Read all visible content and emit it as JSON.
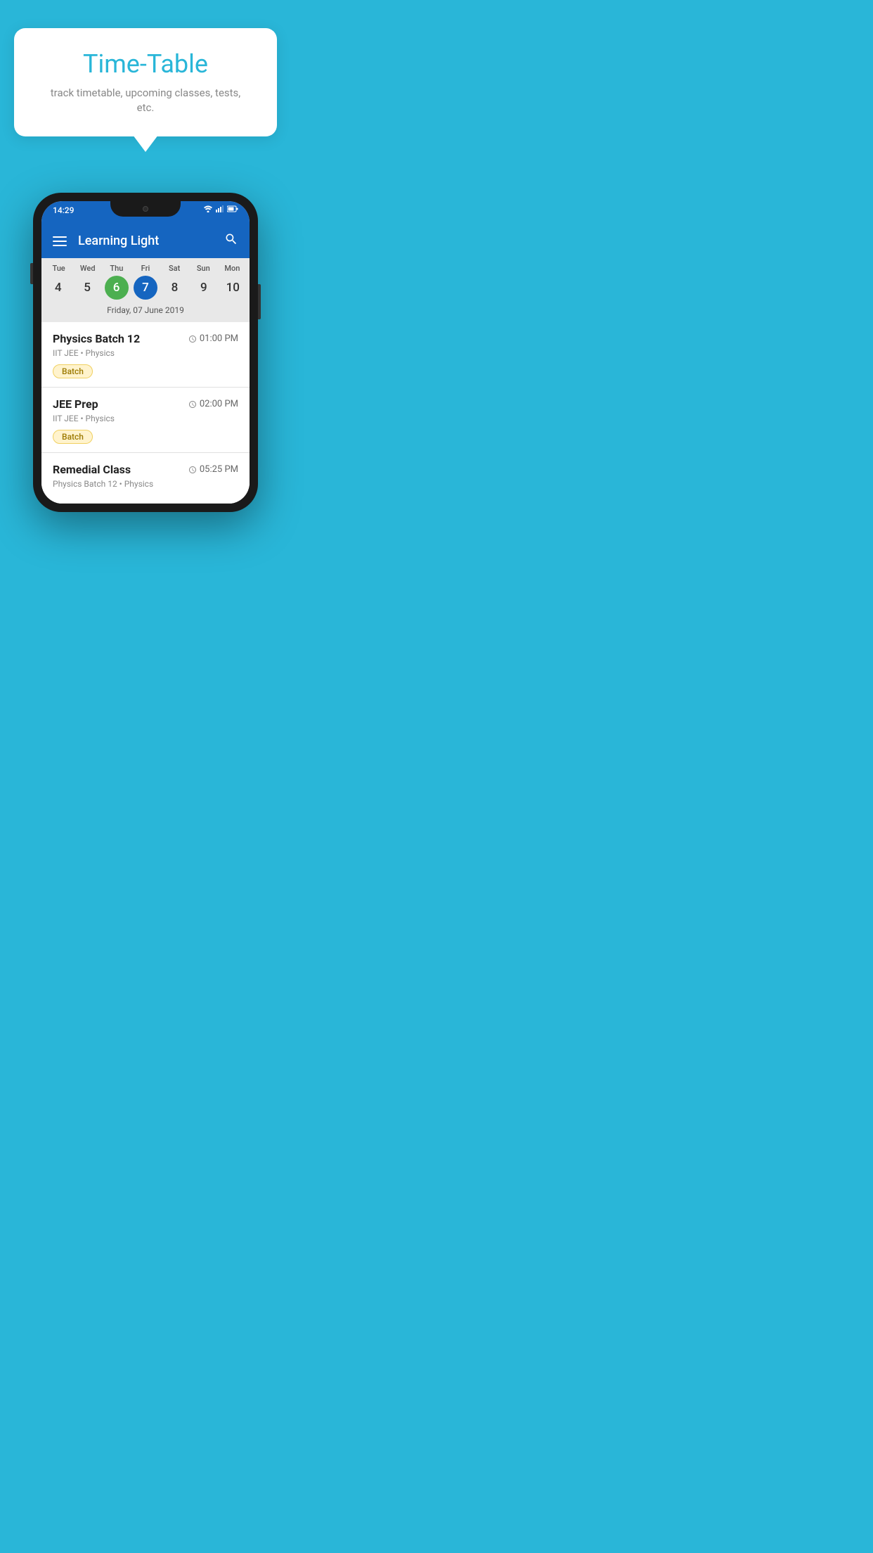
{
  "background_color": "#29B6D8",
  "bubble": {
    "title": "Time-Table",
    "subtitle": "track timetable, upcoming classes, tests, etc."
  },
  "app": {
    "toolbar_title": "Learning Light",
    "time": "14:29"
  },
  "calendar": {
    "days_of_week": [
      "Tue",
      "Wed",
      "Thu",
      "Fri",
      "Sat",
      "Sun",
      "Mon"
    ],
    "dates": [
      "4",
      "5",
      "6",
      "7",
      "8",
      "9",
      "10"
    ],
    "today_index": 2,
    "selected_index": 3,
    "selected_date_label": "Friday, 07 June 2019"
  },
  "classes": [
    {
      "name": "Physics Batch 12",
      "time": "01:00 PM",
      "meta": "IIT JEE • Physics",
      "tag": "Batch"
    },
    {
      "name": "JEE Prep",
      "time": "02:00 PM",
      "meta": "IIT JEE • Physics",
      "tag": "Batch"
    },
    {
      "name": "Remedial Class",
      "time": "05:25 PM",
      "meta": "Physics Batch 12 • Physics",
      "tag": null
    }
  ],
  "icons": {
    "hamburger": "menu",
    "search": "search",
    "clock": "🕐"
  }
}
